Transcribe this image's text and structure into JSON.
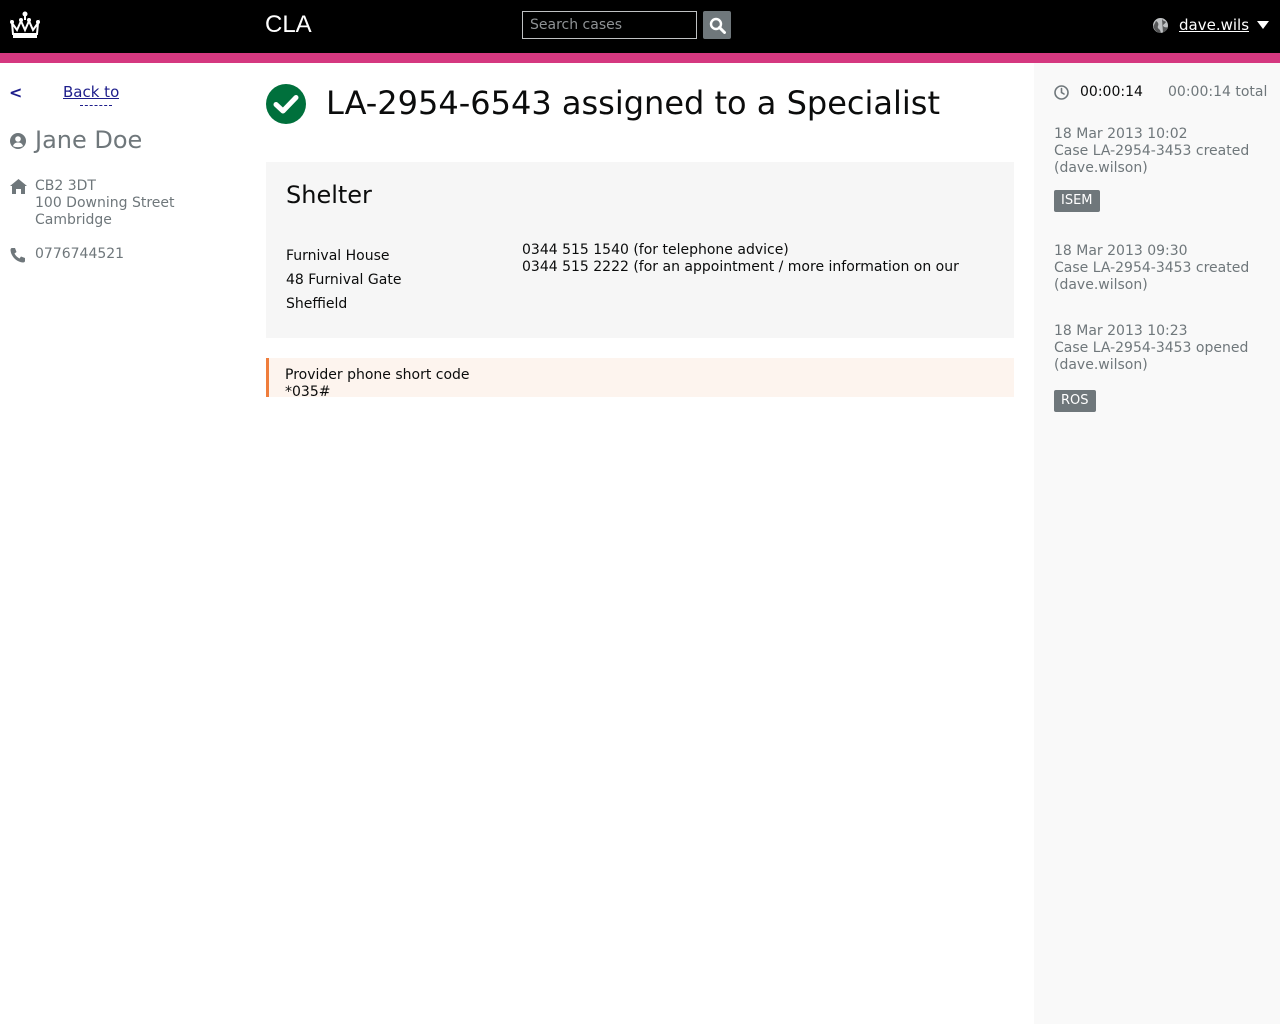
{
  "header": {
    "app_title": "CLA",
    "search": {
      "placeholder": "Search cases",
      "value": ""
    },
    "user": "dave.wilso"
  },
  "sidebar": {
    "back_label": "Back to",
    "chevron": "<",
    "person_name": "Jane Doe",
    "address": [
      "CB2 3DT",
      "100 Downing Street",
      "Cambridge"
    ],
    "phone": "0776744521"
  },
  "main": {
    "title": "LA-2954-6543 assigned to a Specialist",
    "provider": {
      "name": "Shelter",
      "address": [
        "Furnival House",
        "48 Furnival Gate",
        "Sheffield"
      ],
      "phones": [
        "0344 515 1540 (for telephone advice)",
        "0344 515 2222 (for an appointment / more information on our"
      ]
    },
    "notice": {
      "label": "Provider phone short code",
      "code": "*035#"
    }
  },
  "timeline": {
    "timer": "00:00:14",
    "timer_total": "00:00:14 total",
    "events": [
      {
        "date": "18 Mar 2013 10:02",
        "text": "Case LA-2954-3453 created",
        "user": "(dave.wilson)",
        "tag": "ISEM"
      },
      {
        "date": "18 Mar 2013 09:30",
        "text": "Case LA-2954-3453 created",
        "user": "(dave.wilson)",
        "tag": ""
      },
      {
        "date": "18 Mar 2013 10:23",
        "text": "Case LA-2954-3453 opened",
        "user": "(dave.wilson)",
        "tag": "ROS"
      }
    ]
  },
  "colors": {
    "header_bg": "#000000",
    "brand_stripe": "#d53880",
    "success_green": "#00703c",
    "notice_border": "#ef7d3c",
    "link": "#1d1d8b"
  },
  "icons": [
    "crown-logo-icon",
    "search-icon",
    "globe-icon",
    "caret-down-icon",
    "person-icon",
    "home-icon",
    "phone-icon",
    "check-circle-icon",
    "clock-icon"
  ]
}
